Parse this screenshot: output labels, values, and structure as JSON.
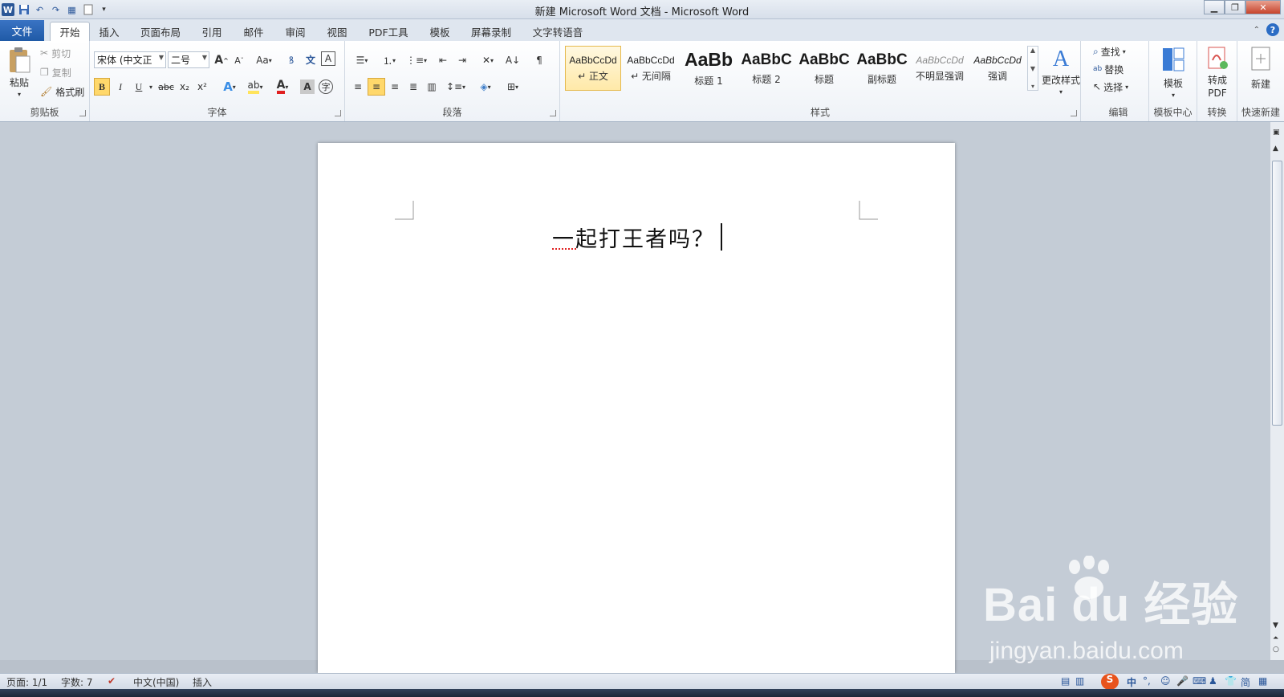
{
  "window": {
    "title": "新建 Microsoft Word 文档 - Microsoft Word",
    "controls": [
      "minimize-icon",
      "maximize-icon",
      "close-icon"
    ]
  },
  "qat": {
    "icons": [
      "word-logo-icon",
      "save-icon",
      "undo-icon",
      "redo-icon",
      "format-painter-icon",
      "new-doc-icon",
      "customize-icon"
    ]
  },
  "tabs": {
    "file": "文件",
    "items": [
      "开始",
      "插入",
      "页面布局",
      "引用",
      "邮件",
      "审阅",
      "视图",
      "PDF工具",
      "模板",
      "屏幕录制",
      "文字转语音"
    ],
    "active": "开始"
  },
  "clipboard": {
    "label": "剪贴板",
    "paste": "粘贴",
    "cut": "剪切",
    "copy": "复制",
    "format_painter": "格式刷"
  },
  "font": {
    "label": "字体",
    "family": "宋体 (中文正",
    "size": "二号",
    "bold": "B",
    "italic": "I",
    "underline": "U",
    "strike": "abc",
    "sub": "x₂",
    "sup": "x²",
    "case": "Aa",
    "grow": "A",
    "shrink": "A"
  },
  "paragraph": {
    "label": "段落"
  },
  "styles": {
    "label": "样式",
    "items": [
      {
        "sample": "AaBbCcDd",
        "name": "↵ 正文"
      },
      {
        "sample": "AaBbCcDd",
        "name": "↵ 无间隔"
      },
      {
        "sample": "AaBb",
        "name": "标题 1"
      },
      {
        "sample": "AaBbC",
        "name": "标题 2"
      },
      {
        "sample": "AaBbC",
        "name": "标题"
      },
      {
        "sample": "AaBbC",
        "name": "副标题"
      },
      {
        "sample": "AaBbCcDd",
        "name": "不明显强调"
      },
      {
        "sample": "AaBbCcDd",
        "name": "强调"
      }
    ],
    "change": "更改样式"
  },
  "editing": {
    "label": "编辑",
    "find": "查找",
    "replace": "替换",
    "select": "选择"
  },
  "template_group": {
    "label": "模板中心",
    "button": "模板"
  },
  "convert_group": {
    "label": "转换",
    "button_line1": "转成",
    "button_line2": "PDF"
  },
  "quicknew_group": {
    "label": "快速新建",
    "button": "新建"
  },
  "document": {
    "text": "一起打王者吗？"
  },
  "status": {
    "page": "页面: 1/1",
    "words": "字数: 7",
    "language": "中文(中国)",
    "mode": "插入"
  },
  "ime": {
    "brand": "S",
    "lang": "中",
    "punct": "°,"
  },
  "watermark": {
    "logo": "Bai du 经验",
    "site": "jingyan.baidu.com"
  },
  "colors": {
    "accent": "#2b5797",
    "highlight": "#ffe45c",
    "font_color": "#e02020"
  }
}
